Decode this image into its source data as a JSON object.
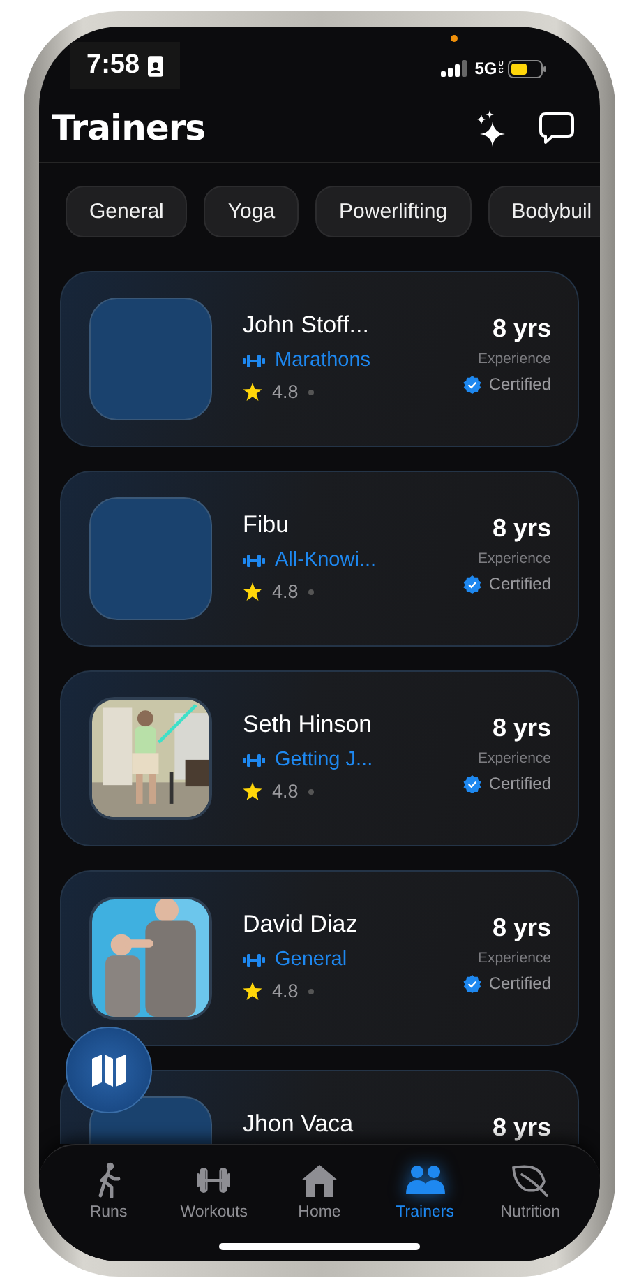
{
  "status_bar": {
    "time": "7:58",
    "network": "5G",
    "network_badge": "UC"
  },
  "header": {
    "title": "Trainers"
  },
  "categories": [
    {
      "label": "General"
    },
    {
      "label": "Yoga"
    },
    {
      "label": "Powerlifting"
    },
    {
      "label": "Bodybuil"
    }
  ],
  "trainers": [
    {
      "name": "John Stoff...",
      "specialty": "Marathons",
      "rating": "4.8",
      "years": "8 yrs",
      "experience_label": "Experience",
      "certified_label": "Certified",
      "kind": "blank"
    },
    {
      "name": "Fibu",
      "specialty": "All-Knowi...",
      "rating": "4.8",
      "years": "8 yrs",
      "experience_label": "Experience",
      "certified_label": "Certified",
      "kind": "blank"
    },
    {
      "name": "Seth Hinson",
      "specialty": "Getting J...",
      "rating": "4.8",
      "years": "8 yrs",
      "experience_label": "Experience",
      "certified_label": "Certified",
      "kind": "picture"
    },
    {
      "name": "David Diaz",
      "specialty": "General",
      "rating": "4.8",
      "years": "8 yrs",
      "experience_label": "Experience",
      "certified_label": "Certified",
      "kind": "picture"
    },
    {
      "name": "Jhon Vaca",
      "years": "8 yrs",
      "kind": "blank"
    }
  ],
  "tab_bar": [
    {
      "label": "Runs",
      "selected": false
    },
    {
      "label": "Workouts",
      "selected": false
    },
    {
      "label": "Home",
      "selected": false
    },
    {
      "label": "Trainers",
      "selected": true
    },
    {
      "label": "Nutrition",
      "selected": false
    }
  ]
}
